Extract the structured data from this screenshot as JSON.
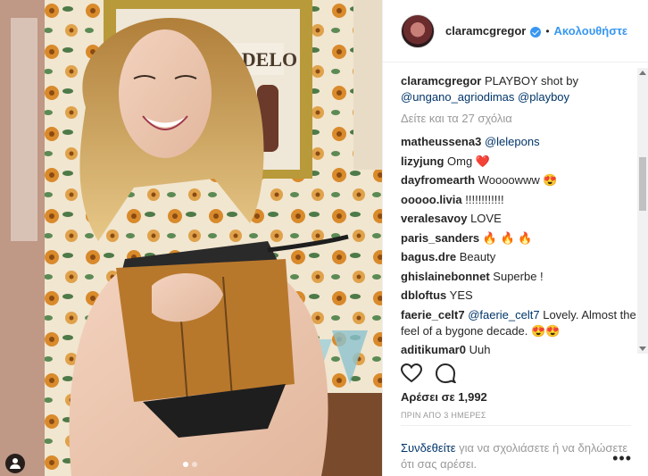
{
  "header": {
    "username": "claramcgregor",
    "separator": "•",
    "follow_label": "Ακολουθήστε"
  },
  "caption": {
    "username": "claramcgregor",
    "text_pre": "PLAYBOY shot by",
    "mention1": "@ungano_agriodimas",
    "mention2": "@playboy"
  },
  "more_comments": "Δείτε και τα 27 σχόλια",
  "comments": [
    {
      "user": "matheussena3",
      "mention": "@lelepons",
      "text": ""
    },
    {
      "user": "lizyjung",
      "text": "Omg ❤️"
    },
    {
      "user": "dayfromearth",
      "text": "Woooowww 😍"
    },
    {
      "user": "ooooo.livia",
      "text": "!!!!!!!!!!!!"
    },
    {
      "user": "veralesavoy",
      "text": "LOVE"
    },
    {
      "user": "paris_sanders",
      "text": "🔥 🔥 🔥"
    },
    {
      "user": "bagus.dre",
      "text": "Beauty"
    },
    {
      "user": "ghislainebonnet",
      "text": "Superbe !"
    },
    {
      "user": "dbloftus",
      "text": "YES"
    },
    {
      "user": "faerie_celt7",
      "mention": "@faerie_celt7",
      "text": "Lovely. Almost the feel of a bygone decade. 😍😍"
    },
    {
      "user": "aditikumar0",
      "text": "Uuh"
    }
  ],
  "likes": "Αρέσει σε 1,992",
  "time": "ΠΡΙΝ ΑΠΟ 3 ΗΜΕΡΕΣ",
  "add_comment": {
    "link": "Συνδεθείτε",
    "rest": "για να σχολιάσετε ή να δηλώσετε ότι σας αρέσει."
  },
  "more_options": "•••",
  "photo": {
    "sign_text": "MODELO",
    "carousel_count": 2,
    "carousel_active": 0
  },
  "icons": [
    "heart-icon",
    "comment-icon",
    "verified-badge-icon",
    "user-tag-icon"
  ]
}
